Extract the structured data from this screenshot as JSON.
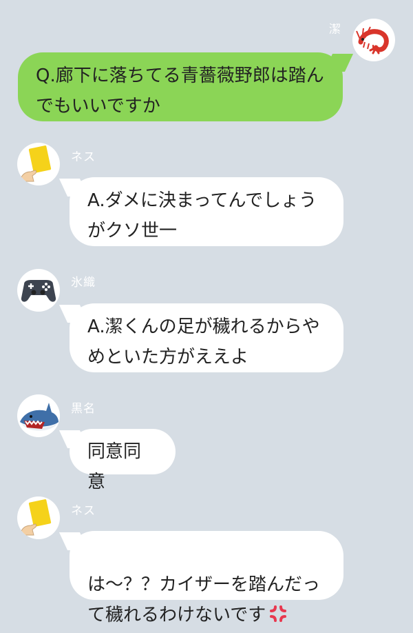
{
  "messages": [
    {
      "sender": "潔",
      "avatar": "shrimp-icon",
      "direction": "outgoing",
      "text": "Q.廊下に落ちてる青薔薇野郎は踏ん\nでもいいですか"
    },
    {
      "sender": "ネス",
      "avatar": "yellow-card-icon",
      "direction": "incoming",
      "text": "A.ダメに決まってんでしょう\nがクソ世一"
    },
    {
      "sender": "氷織",
      "avatar": "game-controller-icon",
      "direction": "incoming",
      "text": "A.潔くんの足が穢れるからや\nめといた方がええよ"
    },
    {
      "sender": "黒名",
      "avatar": "shark-icon",
      "direction": "incoming",
      "text": "同意同意"
    },
    {
      "sender": "ネス",
      "avatar": "yellow-card-icon",
      "direction": "incoming",
      "text": "は〜？？カイザーを踏んだっ\nて穢れるわけないです",
      "emoji": "anger-icon"
    }
  ],
  "colors": {
    "background": "#d6dde4",
    "outgoing_bubble": "#8bd556",
    "incoming_bubble": "#ffffff",
    "name_text": "#ffffff",
    "anger": "#e8384f"
  }
}
